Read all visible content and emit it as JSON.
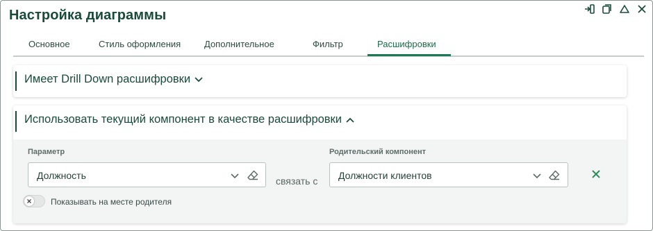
{
  "dialog": {
    "title": "Настройка диаграммы"
  },
  "window_controls": [
    {
      "name": "detach-icon"
    },
    {
      "name": "restore-icon"
    },
    {
      "name": "collapse-icon"
    },
    {
      "name": "close-icon"
    }
  ],
  "tabs": [
    {
      "label": "Основное",
      "active": false
    },
    {
      "label": "Стиль оформления",
      "active": false
    },
    {
      "label": "Дополнительное",
      "active": false
    },
    {
      "label": "Фильтр",
      "active": false
    },
    {
      "label": "Расшифровки",
      "active": true
    }
  ],
  "drilldown_section": {
    "title": "Имеет Drill Down расшифровки",
    "expanded": false
  },
  "component_section": {
    "title": "Использовать текущий компонент в качестве расшифровки",
    "expanded": true,
    "parameter": {
      "label": "Параметр",
      "value": "Должность"
    },
    "link_text": "связать с",
    "parent_component": {
      "label": "Родительский компонент",
      "value": "Должности клиентов"
    },
    "show_in_parent": {
      "label": "Показывать на месте родителя",
      "checked": false
    }
  },
  "colors": {
    "accent": "#1a7a53",
    "title": "#1a4a3a",
    "remove": "#2e8b57"
  }
}
